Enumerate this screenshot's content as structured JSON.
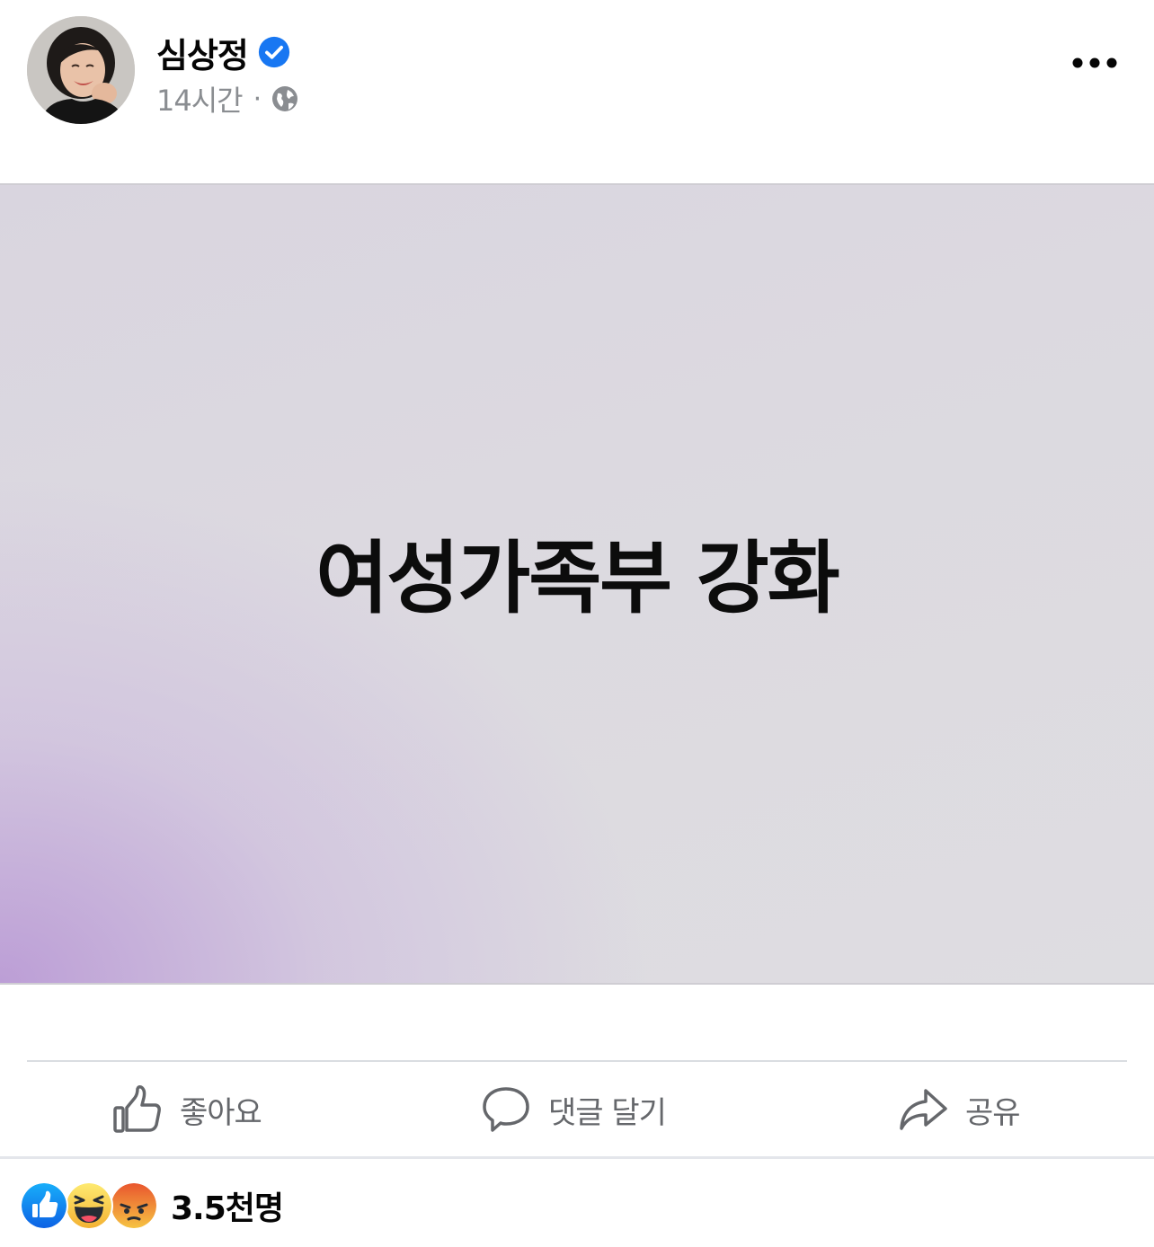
{
  "post": {
    "author": {
      "name": "심상정",
      "verified": true,
      "avatar": "profile-photo"
    },
    "meta": {
      "time": "14시간",
      "separator": "·",
      "audience_icon": "globe-icon"
    },
    "more_icon": "more-horizontal-icon",
    "image": {
      "text": "여성가족부 강화",
      "gradient_colors": [
        "#bc9ed6",
        "#dedde1"
      ]
    }
  },
  "actions": {
    "like": {
      "label": "좋아요",
      "icon": "thumbs-up-outline-icon"
    },
    "comment": {
      "label": "댓글 달기",
      "icon": "comment-bubble-icon"
    },
    "share": {
      "label": "공유",
      "icon": "share-arrow-icon"
    }
  },
  "reactions": {
    "types": [
      "like",
      "haha",
      "angry"
    ],
    "count_text": "3.5천명"
  },
  "colors": {
    "verified_blue": "#1877f2",
    "secondary_text": "#65676b",
    "meta_text": "#8a8d91",
    "divider": "#dadde1"
  }
}
